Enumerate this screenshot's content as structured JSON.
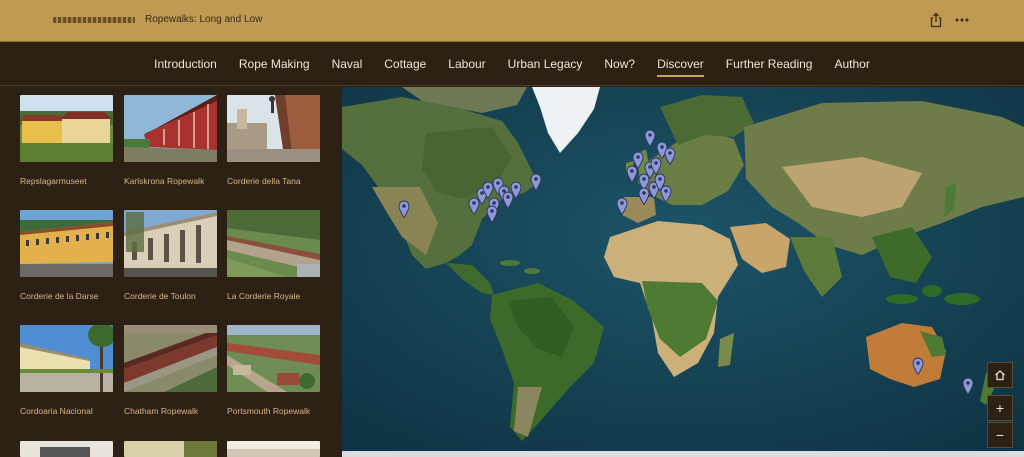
{
  "header": {
    "title": "Ropewalks: Long and Low"
  },
  "nav": {
    "items": [
      {
        "label": "Introduction"
      },
      {
        "label": "Rope Making"
      },
      {
        "label": "Naval"
      },
      {
        "label": "Cottage"
      },
      {
        "label": "Labour"
      },
      {
        "label": "Urban Legacy"
      },
      {
        "label": "Now?"
      },
      {
        "label": "Discover"
      },
      {
        "label": "Further Reading"
      },
      {
        "label": "Author"
      }
    ],
    "active": "Discover"
  },
  "gallery": {
    "items": [
      {
        "caption": "Repslagarmuseet"
      },
      {
        "caption": "Karlskrona Ropewalk"
      },
      {
        "caption": "Corderie della Tana"
      },
      {
        "caption": "Corderie de la Darse"
      },
      {
        "caption": "Corderie de Toulon"
      },
      {
        "caption": "La Corderie Royale"
      },
      {
        "caption": "Cordoaria Nacional"
      },
      {
        "caption": "Chatham Ropewalk"
      },
      {
        "caption": "Portsmouth Ropewalk"
      }
    ]
  },
  "map_controls": {
    "home": "home-icon",
    "zoom_in": "+",
    "zoom_out": "−"
  },
  "colors": {
    "header_bg": "#c09a52",
    "nav_bg": "#2d2014",
    "caption": "#d9b787",
    "marker": "#8e98d6",
    "ocean": "#123c4d"
  }
}
